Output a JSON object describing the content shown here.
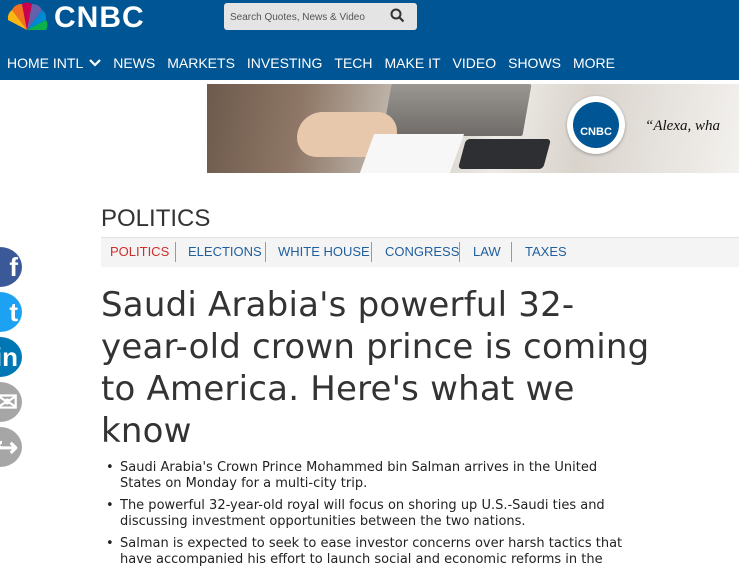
{
  "header": {
    "logo_text": "CNBC",
    "search_placeholder": "Search Quotes, News & Video",
    "nav": [
      "HOME INTL",
      "NEWS",
      "MARKETS",
      "INVESTING",
      "TECH",
      "MAKE IT",
      "VIDEO",
      "SHOWS",
      "MORE"
    ]
  },
  "banner": {
    "logo_text": "CNBC",
    "quote": "“Alexa, wha"
  },
  "section": {
    "title": "POLITICS",
    "subnav": [
      "POLITICS",
      "ELECTIONS",
      "WHITE HOUSE",
      "CONGRESS",
      "LAW",
      "TAXES"
    ]
  },
  "article": {
    "headline": "Saudi Arabia's powerful 32-year-old crown prince is coming to America. Here's what we know",
    "bullets": [
      "Saudi Arabia's Crown Prince Mohammed bin Salman arrives in the United States on Monday for a multi-city trip.",
      "The powerful 32-year-old royal will focus on shoring up U.S.-Saudi ties and discussing investment opportunities between the two nations.",
      "Salman is expected to seek to ease investor concerns over harsh tactics that have accompanied his effort to launch social and economic reforms in the"
    ]
  },
  "social": [
    {
      "name": "facebook",
      "glyph": "f",
      "color": "#3b5998"
    },
    {
      "name": "twitter",
      "glyph": "t",
      "color": "#1da1f2"
    },
    {
      "name": "linkedin",
      "glyph": "in",
      "color": "#0077b5"
    },
    {
      "name": "email",
      "glyph": "✉",
      "color": "#a6a6a6"
    },
    {
      "name": "share",
      "glyph": "↪",
      "color": "#a6a6a6"
    }
  ]
}
